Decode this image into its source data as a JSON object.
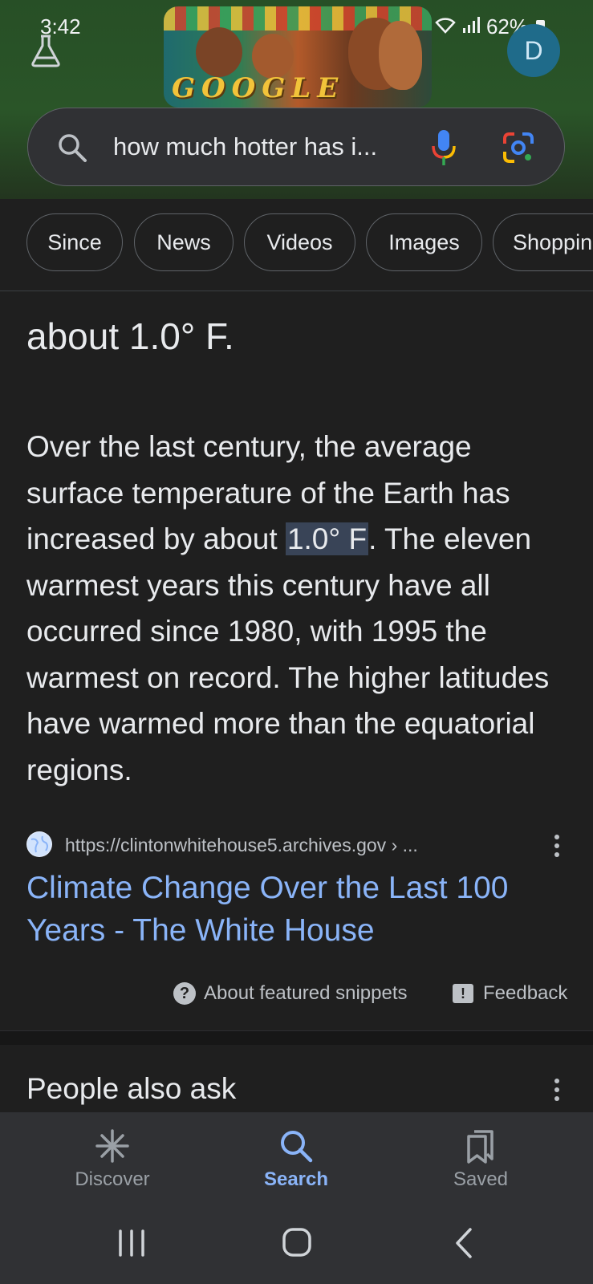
{
  "status_bar": {
    "time": "3:42",
    "battery": "62%",
    "icons": [
      "recycle-icon",
      "wifi-icon",
      "signal-icon",
      "battery-icon"
    ]
  },
  "header": {
    "labs_icon": "flask-icon",
    "doodle_text": "GOOGLE",
    "avatar_letter": "D",
    "colors": {
      "header_green": "#2a5528",
      "avatar_bg": "#1f6b8a"
    }
  },
  "search": {
    "query": "how much hotter has i...",
    "icons": [
      "search-icon",
      "mic-icon",
      "lens-icon"
    ]
  },
  "chips": [
    "Since",
    "News",
    "Videos",
    "Images",
    "Shoppin"
  ],
  "snippet": {
    "answer": "about 1.0° F.",
    "text_before": "Over the last century, the average surface temperature of the Earth has increased by about ",
    "highlight": "1.0° F",
    "text_after": ". The eleven warmest years this century have all occurred since 1980, with 1995 the warmest on record. The higher latitudes have warmed more than the equatorial regions.",
    "source_url": "https://clintonwhitehouse5.archives.gov › ...",
    "title": "Climate Change Over the Last 100 Years - The White House",
    "about_label": "About featured snippets",
    "feedback_label": "Feedback"
  },
  "people_also_ask": {
    "title": "People also ask"
  },
  "bottom_nav": {
    "items": [
      {
        "label": "Discover",
        "icon": "asterisk-icon",
        "active": false
      },
      {
        "label": "Search",
        "icon": "search-icon",
        "active": true
      },
      {
        "label": "Saved",
        "icon": "bookmarks-icon",
        "active": false
      }
    ],
    "colors": {
      "active": "#8ab4f8",
      "inactive": "#9aa0a6"
    }
  },
  "system_nav": [
    "recent-apps-icon",
    "home-icon",
    "back-icon"
  ]
}
